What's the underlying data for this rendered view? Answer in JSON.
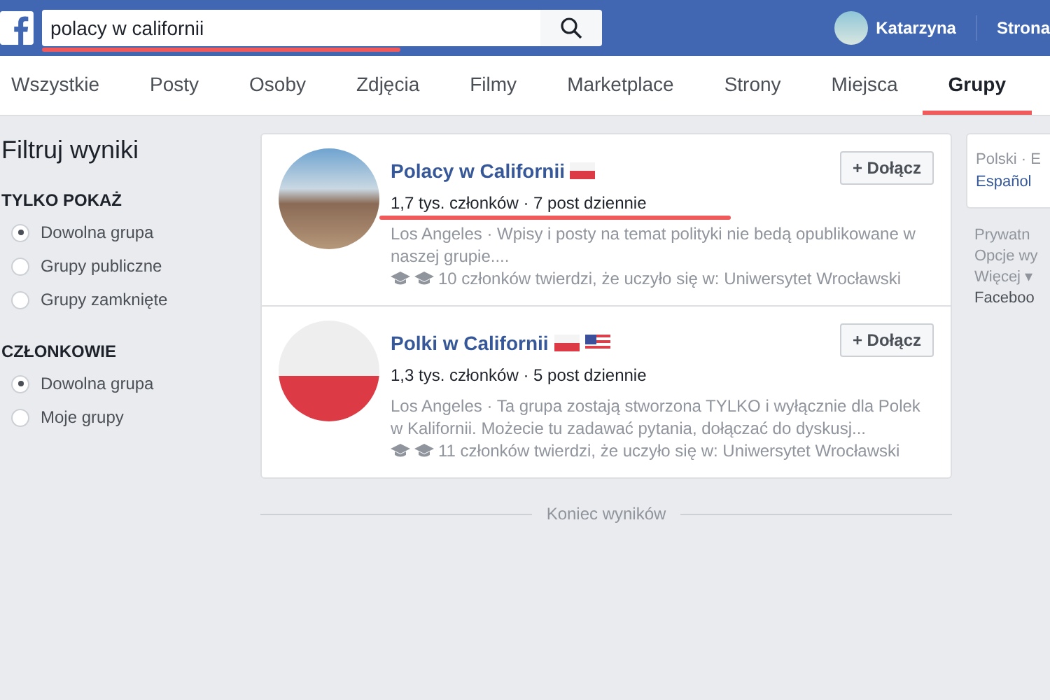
{
  "topbar": {
    "search": {
      "value": "polacy w californii",
      "underlined": true
    },
    "user": "Katarzyna",
    "link": "Strona"
  },
  "tabs": [
    {
      "label": "Wszystkie",
      "selected": false
    },
    {
      "label": "Posty",
      "selected": false
    },
    {
      "label": "Osoby",
      "selected": false
    },
    {
      "label": "Zdjęcia",
      "selected": false
    },
    {
      "label": "Filmy",
      "selected": false
    },
    {
      "label": "Marketplace",
      "selected": false
    },
    {
      "label": "Strony",
      "selected": false
    },
    {
      "label": "Miejsca",
      "selected": false
    },
    {
      "label": "Grupy",
      "selected": true
    }
  ],
  "filters": {
    "title": "Filtruj wyniki",
    "sections": [
      {
        "heading": "TYLKO POKAŻ",
        "options": [
          {
            "label": "Dowolna grupa",
            "selected": true
          },
          {
            "label": "Grupy publiczne",
            "selected": false
          },
          {
            "label": "Grupy zamknięte",
            "selected": false
          }
        ]
      },
      {
        "heading": "CZŁONKOWIE",
        "options": [
          {
            "label": "Dowolna grupa",
            "selected": true
          },
          {
            "label": "Moje grupy",
            "selected": false
          }
        ]
      }
    ]
  },
  "results": [
    {
      "name": "Polacy w Californii",
      "flags": [
        {
          "kind": "pl"
        }
      ],
      "meta": "1,7 tys. członków · 7 post dziennie",
      "underlined": true,
      "description": "Los Angeles · Wpisy i posty na temat polityki nie bedą opublikowane w naszej grupie....",
      "education": "10 członków twierdzi, że uczyło się w: Uniwersytet Wrocławski",
      "button": "+ Dołącz",
      "kind": "beach"
    },
    {
      "name": "Polki w Californii",
      "flags": [
        {
          "kind": "pl"
        },
        {
          "kind": "us"
        }
      ],
      "meta": "1,3 tys. członków · 5 post dziennie",
      "underlined": false,
      "description": "Los Angeles · Ta grupa zostają stworzona TYLKO i wyłącznie dla Polek w Kalifornii. Możecie tu zadawać pytania, dołączać do dyskusj...",
      "education": "11 członków twierdzi, że uczyło się w: Uniwersytet Wrocławski",
      "button": "+ Dołącz",
      "kind": "emblem"
    }
  ],
  "end_label": "Koniec wyników",
  "right": {
    "languages": [
      "Polski · E",
      "Español"
    ],
    "footer": [
      "Prywatn",
      "Opcje wy",
      "Więcej ▾",
      "Faceboo"
    ]
  }
}
